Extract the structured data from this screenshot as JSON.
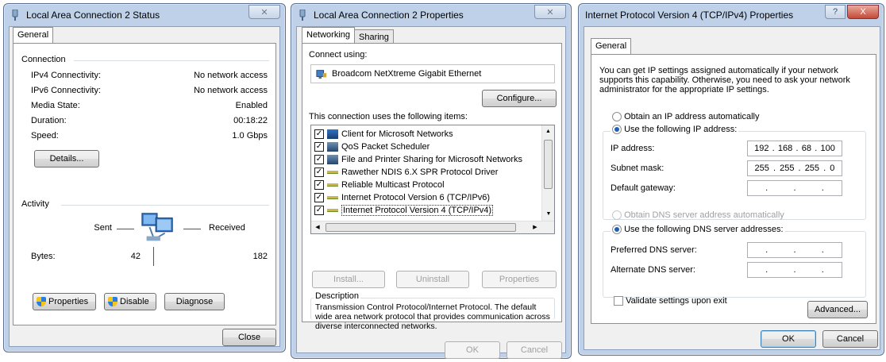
{
  "status_window": {
    "title": "Local Area Connection 2 Status",
    "tab_general": "General",
    "connection_label": "Connection",
    "rows": [
      {
        "label": "IPv4 Connectivity:",
        "value": "No network access"
      },
      {
        "label": "IPv6 Connectivity:",
        "value": "No network access"
      },
      {
        "label": "Media State:",
        "value": "Enabled"
      },
      {
        "label": "Duration:",
        "value": "00:18:22"
      },
      {
        "label": "Speed:",
        "value": "1.0 Gbps"
      }
    ],
    "details_button": "Details...",
    "activity_label": "Activity",
    "sent_label": "Sent",
    "received_label": "Received",
    "bytes_label": "Bytes:",
    "bytes_sent": "42",
    "bytes_received": "182",
    "properties_button": "Properties",
    "disable_button": "Disable",
    "diagnose_button": "Diagnose",
    "close_button": "Close"
  },
  "properties_window": {
    "title": "Local Area Connection 2 Properties",
    "tab_networking": "Networking",
    "tab_sharing": "Sharing",
    "connect_using_label": "Connect using:",
    "adapter_name": "Broadcom NetXtreme Gigabit Ethernet",
    "configure_button": "Configure...",
    "items_label": "This connection uses the following items:",
    "items": [
      {
        "label": "Client for Microsoft Networks",
        "checked": true,
        "icon": "network-client-icon"
      },
      {
        "label": "QoS Packet Scheduler",
        "checked": true,
        "icon": "service-icon"
      },
      {
        "label": "File and Printer Sharing for Microsoft Networks",
        "checked": true,
        "icon": "service-icon"
      },
      {
        "label": "Rawether NDIS 6.X SPR Protocol Driver",
        "checked": true,
        "icon": "protocol-icon"
      },
      {
        "label": "Reliable Multicast Protocol",
        "checked": true,
        "icon": "protocol-icon"
      },
      {
        "label": "Internet Protocol Version 6 (TCP/IPv6)",
        "checked": true,
        "icon": "protocol-icon"
      },
      {
        "label": "Internet Protocol Version 4 (TCP/IPv4)",
        "checked": true,
        "icon": "protocol-icon"
      }
    ],
    "install_button": "Install...",
    "uninstall_button": "Uninstall",
    "properties_button": "Properties",
    "description_label": "Description",
    "description_text": "Transmission Control Protocol/Internet Protocol. The default wide area network protocol that provides communication across diverse interconnected networks.",
    "ok_button": "OK",
    "cancel_button": "Cancel"
  },
  "ipv4_window": {
    "title": "Internet Protocol Version 4 (TCP/IPv4) Properties",
    "tab_general": "General",
    "intro_text": "You can get IP settings assigned automatically if your network supports this capability. Otherwise, you need to ask your network administrator for the appropriate IP settings.",
    "obtain_ip_auto": "Obtain an IP address automatically",
    "use_following_ip": "Use the following IP address:",
    "ip_address_label": "IP address:",
    "ip_address": [
      "192",
      "168",
      "68",
      "100"
    ],
    "subnet_mask_label": "Subnet mask:",
    "subnet_mask": [
      "255",
      "255",
      "255",
      "0"
    ],
    "gateway_label": "Default gateway:",
    "obtain_dns_auto": "Obtain DNS server address automatically",
    "use_following_dns": "Use the following DNS server addresses:",
    "preferred_dns_label": "Preferred DNS server:",
    "alternate_dns_label": "Alternate DNS server:",
    "validate_label": "Validate settings upon exit",
    "advanced_button": "Advanced...",
    "ok_button": "OK",
    "cancel_button": "Cancel",
    "help_glyph": "?",
    "close_glyph": "X"
  },
  "colors": {
    "selection": "#3399ff",
    "chrome": "#bfd1e8",
    "close_red": "#c44a37"
  }
}
